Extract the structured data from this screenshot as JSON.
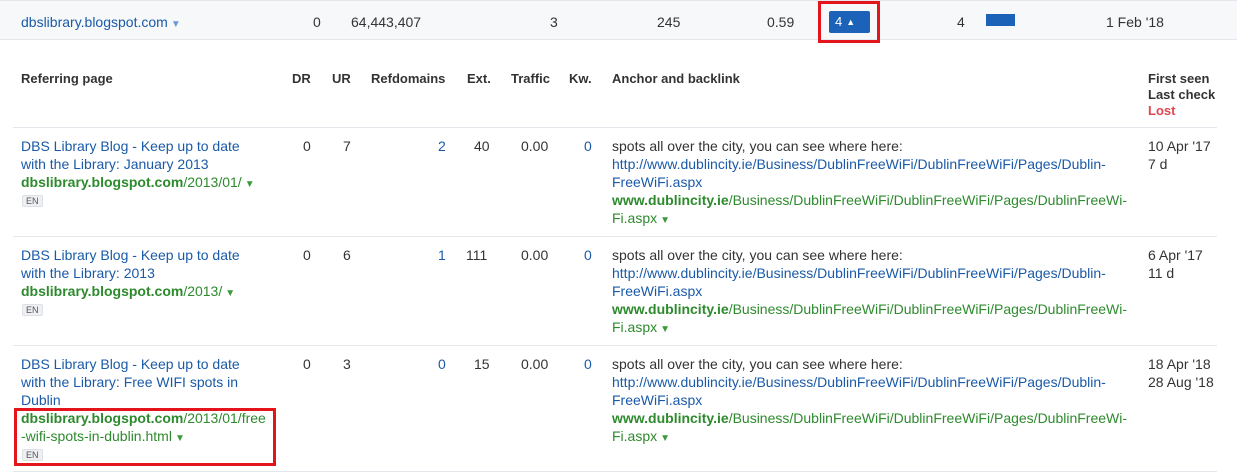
{
  "top_row": {
    "domain": "dbslibrary.blogspot.com",
    "dr": "0",
    "ahrefs_rank": "64,443,407",
    "col3": "3",
    "col4": "245",
    "col5": "0.59",
    "badge_value": "4",
    "badge_arrow": "▲",
    "col7": "4",
    "bar_fraction": 1.0,
    "date": "1 Feb '18",
    "accent_color": "#1b62b8"
  },
  "headers": {
    "referring_page": "Referring page",
    "dr": "DR",
    "ur": "UR",
    "refdomains": "Refdomains",
    "ext": "Ext.",
    "traffic": "Traffic",
    "kw": "Kw.",
    "anchor": "Anchor and backlink",
    "first_seen": "First seen",
    "last_check": "Last check",
    "lost": "Lost"
  },
  "rows": [
    {
      "title_lines": [
        "DBS Library Blog - Keep up to date",
        "with the Library: January 2013"
      ],
      "url_domain": "dbslibrary.blogspot.com",
      "url_path_lines": [
        "/2013/01/"
      ],
      "lang": "EN",
      "dr": "0",
      "ur": "7",
      "refdomains": "2",
      "ext": "40",
      "traffic": "0.00",
      "kw": "0",
      "anchor_text": "spots all over the city, you can see where here:",
      "anchor_link_lines": [
        "http://www.dublincity.ie/Business/DublinFreeWiFi/DublinFreeWiFi/Pages/Dublin-",
        "FreeWiFi.aspx"
      ],
      "backlink_domain": "www.dublincity.ie",
      "backlink_path_lines": [
        "/Business/DublinFreeWiFi/DublinFreeWiFi/Pages/DublinFreeWi-",
        "Fi.aspx"
      ],
      "first_seen": "10 Apr '17",
      "last_check": "7 d"
    },
    {
      "title_lines": [
        "DBS Library Blog - Keep up to date",
        "with the Library: 2013"
      ],
      "url_domain": "dbslibrary.blogspot.com",
      "url_path_lines": [
        "/2013/"
      ],
      "lang": "EN",
      "dr": "0",
      "ur": "6",
      "refdomains": "1",
      "ext": "111",
      "traffic": "0.00",
      "kw": "0",
      "anchor_text": "spots all over the city, you can see where here:",
      "anchor_link_lines": [
        "http://www.dublincity.ie/Business/DublinFreeWiFi/DublinFreeWiFi/Pages/Dublin-",
        "FreeWiFi.aspx"
      ],
      "backlink_domain": "www.dublincity.ie",
      "backlink_path_lines": [
        "/Business/DublinFreeWiFi/DublinFreeWiFi/Pages/DublinFreeWi-",
        "Fi.aspx"
      ],
      "first_seen": "6 Apr '17",
      "last_check": "11 d"
    },
    {
      "title_lines": [
        "DBS Library Blog - Keep up to date",
        "with the Library: Free WIFI spots in",
        "Dublin"
      ],
      "url_domain": "dbslibrary.blogspot.com",
      "url_path_lines": [
        "/2013/01/free",
        "-wifi-spots-in-dublin.html"
      ],
      "lang": "EN",
      "dr": "0",
      "ur": "3",
      "refdomains": "0",
      "ext": "15",
      "traffic": "0.00",
      "kw": "0",
      "anchor_text": "spots all over the city, you can see where here:",
      "anchor_link_lines": [
        "http://www.dublincity.ie/Business/DublinFreeWiFi/DublinFreeWiFi/Pages/Dublin-",
        "FreeWiFi.aspx"
      ],
      "backlink_domain": "www.dublincity.ie",
      "backlink_path_lines": [
        "/Business/DublinFreeWiFi/DublinFreeWiFi/Pages/DublinFreeWi-",
        "Fi.aspx"
      ],
      "first_seen": "18 Apr '18",
      "last_check": "28 Aug '18"
    }
  ]
}
